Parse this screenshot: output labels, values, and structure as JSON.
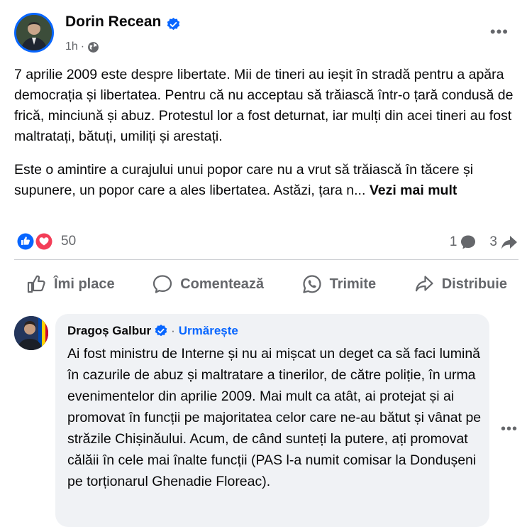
{
  "post": {
    "author": "Dorin Recean",
    "time": "1h",
    "dot": "·",
    "more": "•••",
    "paragraph1": "7 aprilie 2009 este despre libertate. Mii de tineri au ieșit în stradă pentru a apăra democrația și libertatea. Pentru că nu acceptau să trăiască într-o țară condusă de frică, minciună și abuz. Protestul lor a fost deturnat, iar mulți din acei tineri au fost maltratați, bătuți, umiliți și arestați.",
    "paragraph2": "Este o amintire a curajului unui popor care nu a vrut să trăiască în tăcere și supunere, un popor care a ales libertatea. Astăzi, țara n...",
    "see_more": "Vezi mai mult"
  },
  "stats": {
    "reactions_count": "50",
    "comments_count": "1",
    "shares_count": "3"
  },
  "actions": {
    "like": "Îmi place",
    "comment": "Comentează",
    "send": "Trimite",
    "share": "Distribuie"
  },
  "comment": {
    "author": "Dragoș Galbur",
    "separator": "·",
    "follow": "Urmărește",
    "text": "Ai fost ministru de Interne și nu ai mișcat un deget ca să faci lumină în cazurile de abuz și maltratare a tinerilor, de către poliție, în urma evenimentelor din aprilie 2009. Mai mult ca atât, ai protejat și ai promovat în funcții pe majoritatea celor care ne-au bătut și vânat pe străzile Chișinăului. Acum, de când sunteți la putere, ați promovat călăii în cele mai înalte funcții (PAS l-a numit comisar la Dondușeni pe torționarul Ghenadie Floreac).",
    "more": "•••"
  },
  "colors": {
    "accent": "#0866ff",
    "secondary_text": "#65676b",
    "bubble": "#f0f2f5",
    "love": "#f33e58"
  },
  "icons": [
    "verified-badge-icon",
    "globe-icon",
    "like-reaction-icon",
    "love-reaction-icon",
    "comment-icon",
    "share-arrow-icon",
    "thumbs-up-icon",
    "speech-bubble-icon",
    "whatsapp-icon",
    "share-icon"
  ]
}
